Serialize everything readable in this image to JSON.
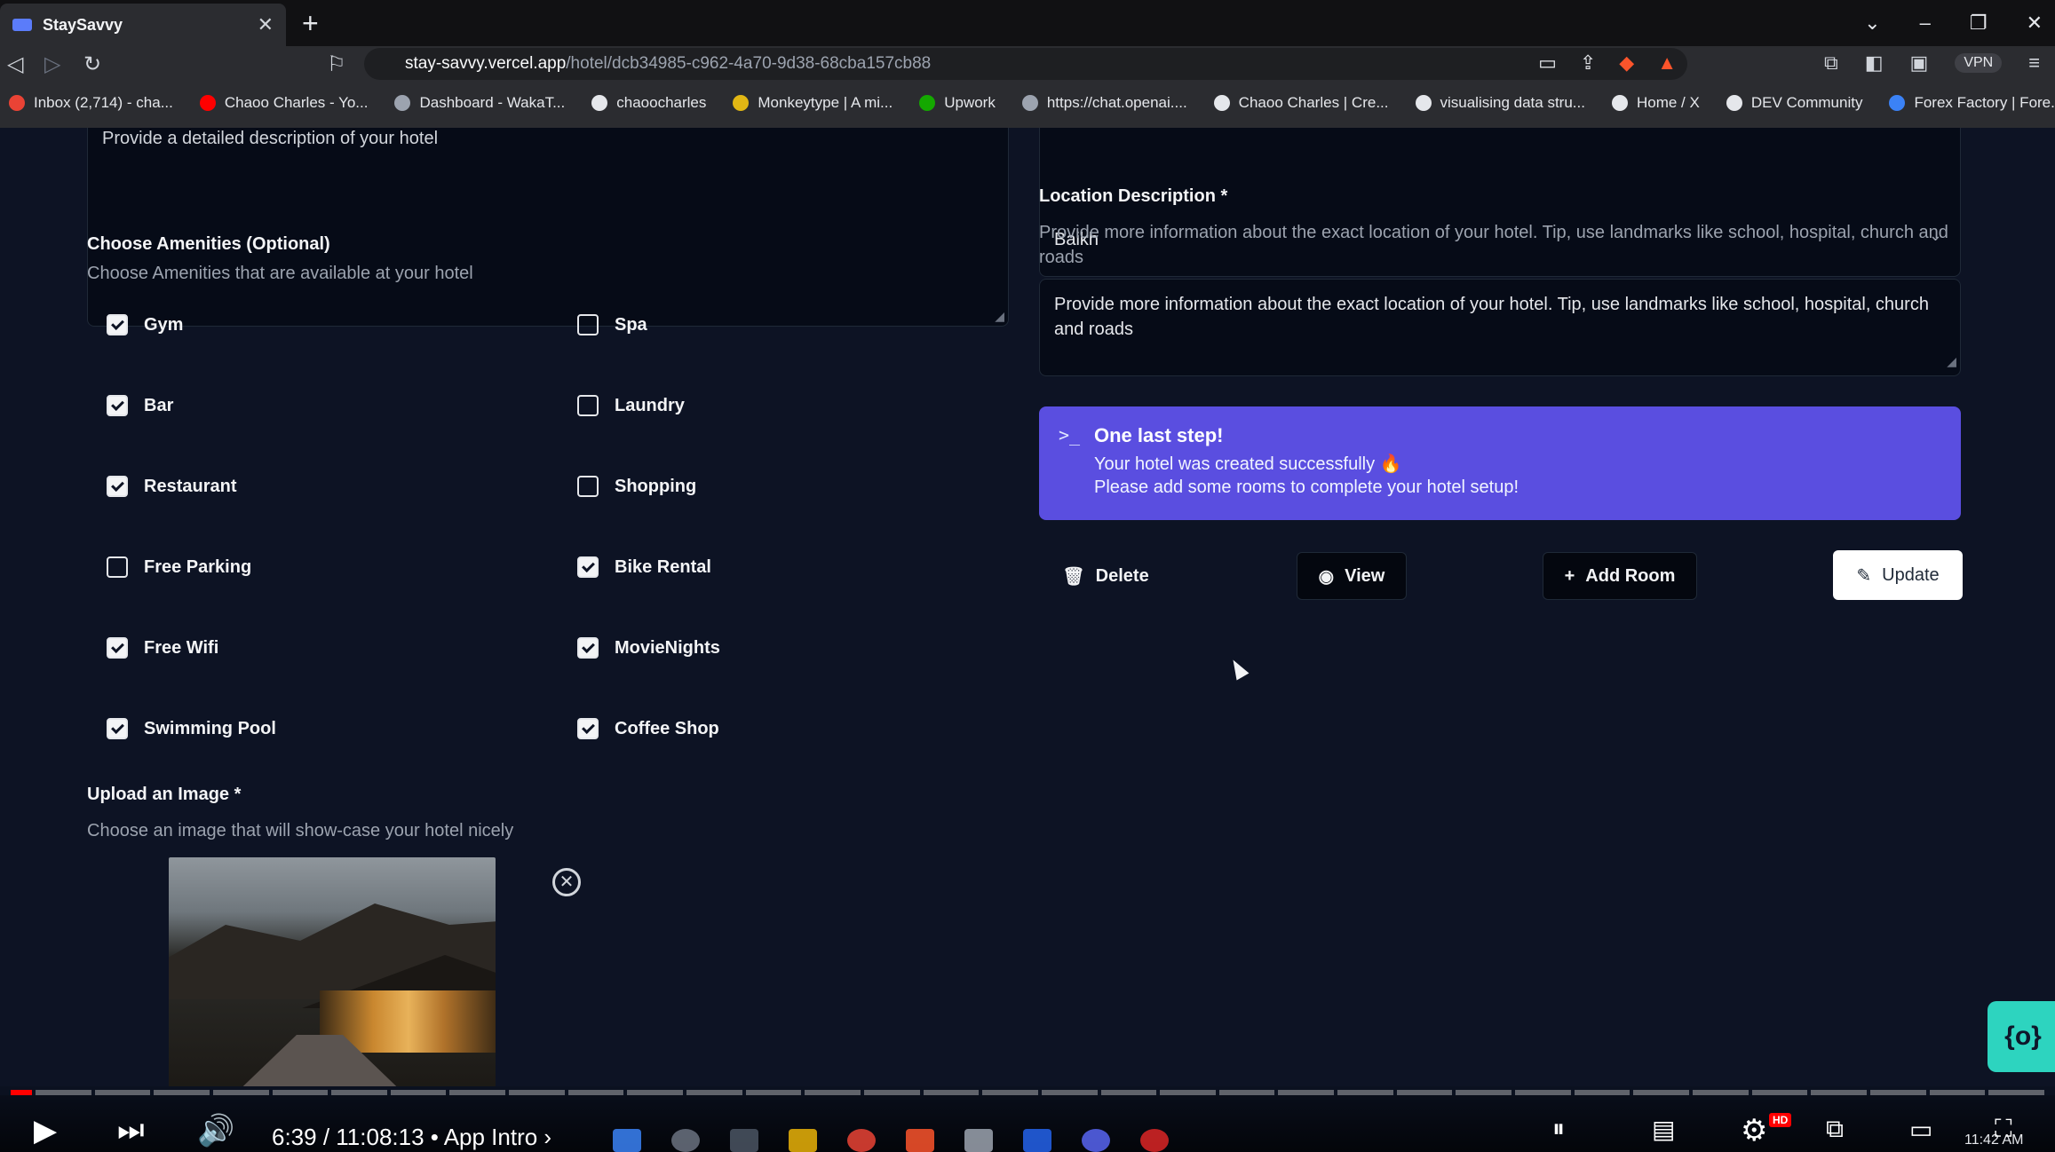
{
  "browser": {
    "tab_title": "StaySavvy",
    "tab_close": "✕",
    "new_tab": "+",
    "url_host": "stay-savvy.vercel.app",
    "url_path": "/hotel/dcb34985-c962-4a70-9d38-68cba157cb88",
    "vpn_label": "VPN",
    "bookmarks": [
      {
        "label": "Inbox (2,714) - cha...",
        "color": "#ea4335"
      },
      {
        "label": "Chaoo Charles - Yo...",
        "color": "#ff0000"
      },
      {
        "label": "Dashboard - WakaT...",
        "color": "#9ca3af"
      },
      {
        "label": "chaoocharles",
        "color": "#e5e7eb"
      },
      {
        "label": "Monkeytype | A mi...",
        "color": "#e2b714"
      },
      {
        "label": "Upwork",
        "color": "#14a800"
      },
      {
        "label": "https://chat.openai....",
        "color": "#9ca3af"
      },
      {
        "label": "Chaoo Charles | Cre...",
        "color": "#e5e7eb"
      },
      {
        "label": "visualising data stru...",
        "color": "#e5e7eb"
      },
      {
        "label": "Home / X",
        "color": "#e5e7eb"
      },
      {
        "label": "DEV Community",
        "color": "#e5e7eb"
      },
      {
        "label": "Forex Factory | Fore...",
        "color": "#3b82f6"
      }
    ]
  },
  "form": {
    "description_placeholder": "Provide a detailed description of your hotel",
    "city_value": "Baikh",
    "amenities": {
      "label": "Choose Amenities (Optional)",
      "hint": "Choose Amenities that are available at your hotel",
      "items": [
        {
          "label": "Gym",
          "checked": true
        },
        {
          "label": "Spa",
          "checked": false
        },
        {
          "label": "Bar",
          "checked": true
        },
        {
          "label": "Laundry",
          "checked": false
        },
        {
          "label": "Restaurant",
          "checked": true
        },
        {
          "label": "Shopping",
          "checked": false
        },
        {
          "label": "Free Parking",
          "checked": false
        },
        {
          "label": "Bike Rental",
          "checked": true
        },
        {
          "label": "Free Wifi",
          "checked": true
        },
        {
          "label": "MovieNights",
          "checked": true
        },
        {
          "label": "Swimming Pool",
          "checked": true
        },
        {
          "label": "Coffee Shop",
          "checked": true
        }
      ]
    },
    "upload": {
      "label": "Upload an Image *",
      "hint": "Choose an image that will show-case your hotel nicely"
    },
    "location": {
      "label": "Location Description *",
      "hint": "Provide more information about the exact location of your hotel. Tip, use landmarks like school, hospital, church and roads",
      "value": "Provide more information about the exact location of your hotel. Tip, use landmarks like school, hospital, church and roads"
    }
  },
  "alert": {
    "icon": ">_",
    "title": "One last step!",
    "line1": "Your hotel was created successfully 🔥",
    "line2": "Please add some rooms to complete your hotel setup!"
  },
  "actions": {
    "delete": "Delete",
    "view": "View",
    "add_room": "Add Room",
    "update": "Update"
  },
  "player": {
    "time": "6:39 / 11:08:13",
    "chapter": "• App Intro",
    "hd": "HD",
    "clock": "11:42 AM"
  }
}
